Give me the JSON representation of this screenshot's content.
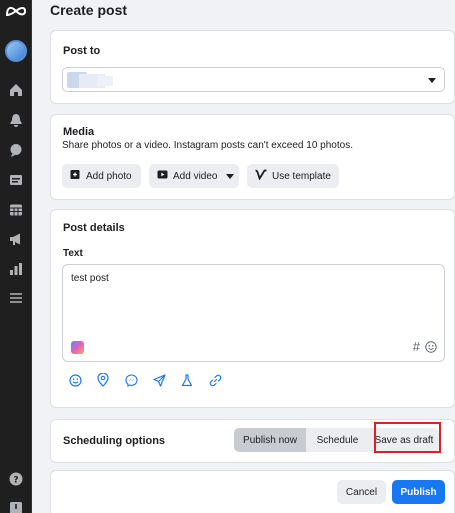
{
  "page": {
    "title": "Create post"
  },
  "post_to": {
    "title": "Post to"
  },
  "media": {
    "title": "Media",
    "subtitle": "Share photos or a video. Instagram posts can't exceed 10 photos.",
    "add_photo": "Add photo",
    "add_video": "Add video",
    "use_template": "Use template"
  },
  "details": {
    "title": "Post details",
    "text_label": "Text",
    "text_value": "test post",
    "hashtag": "#"
  },
  "scheduling": {
    "title": "Scheduling options",
    "publish_now": "Publish now",
    "schedule": "Schedule",
    "save_draft": "Save as draft"
  },
  "footer": {
    "cancel": "Cancel",
    "publish": "Publish"
  },
  "colors": {
    "primary": "#1877f2",
    "rail": "#1f1f1f",
    "highlight": "#e02020"
  }
}
